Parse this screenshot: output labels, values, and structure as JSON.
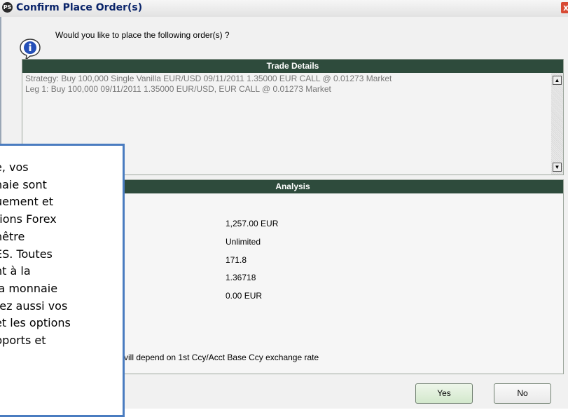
{
  "window": {
    "title": "Confirm Place Order(s)",
    "app_icon": "PS",
    "close_glyph": "x",
    "question": "Would you like to place the following order(s) ?"
  },
  "trade_details": {
    "header": "Trade Details",
    "lines": [
      "Strategy: Buy 100,000 Single Vanilla EUR/USD 09/11/2011 1.35000 EUR CALL @ 0.01273 Market",
      "Leg 1: Buy 100,000 09/11/2011 1.35000 EUR/USD, EUR CALL @ 0.01273 Market"
    ]
  },
  "analysis": {
    "header": "Analysis",
    "values": [
      "1,257.00 EUR",
      "Unlimited",
      "171.8",
      "1.36718",
      "0.00 EUR"
    ],
    "footnote": "vill depend on 1st Ccy/Acct Base Ccy exchange rate"
  },
  "buttons": {
    "yes": "Yes",
    "no": "No"
  },
  "callout": {
    "lines": [
      "e, vos",
      "naie sont",
      "uement et",
      "tions Forex",
      "nêtre",
      "ES. Toutes",
      "nt à la",
      "la monnaie",
      "rez aussi vos",
      "et les options",
      "pports et"
    ]
  },
  "colors": {
    "panel_header": "#2e4b3c",
    "callout_border": "#4a7cc0",
    "close_button": "#d84a34"
  }
}
